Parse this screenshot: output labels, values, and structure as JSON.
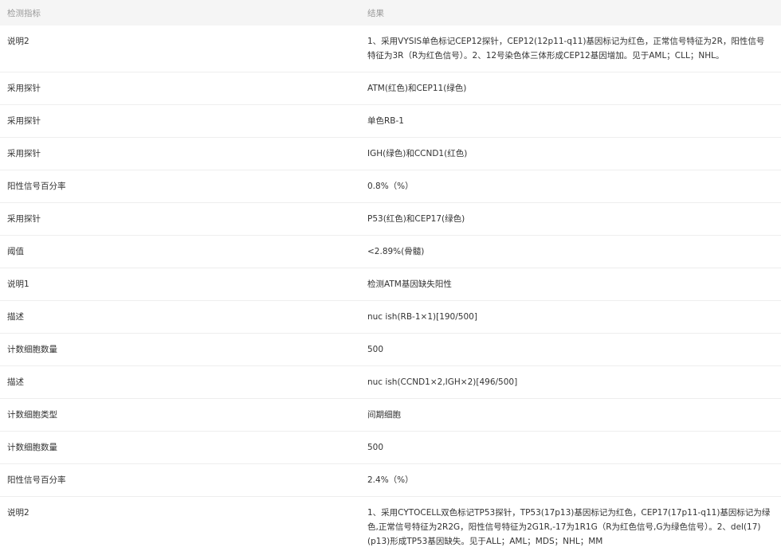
{
  "table": {
    "headers": [
      "检测指标",
      "结果"
    ],
    "rows": [
      {
        "name": "说明2",
        "result": "1、采用VYSIS单色标记CEP12探针，CEP12(12p11-q11)基因标记为红色，正常信号特征为2R，阳性信号特征为3R（R为红色信号）。2、12号染色体三体形成CEP12基因增加。见于AML；CLL；NHL。"
      },
      {
        "name": "采用探针",
        "result": "ATM(红色)和CEP11(绿色)"
      },
      {
        "name": "采用探针",
        "result": "单色RB-1"
      },
      {
        "name": "采用探针",
        "result": "IGH(绿色)和CCND1(红色)"
      },
      {
        "name": "阳性信号百分率",
        "result": "0.8%（%）"
      },
      {
        "name": "采用探针",
        "result": "P53(红色)和CEP17(绿色)"
      },
      {
        "name": "阈值",
        "result": "<2.89%(骨髓)"
      },
      {
        "name": "说明1",
        "result": "检测ATM基因缺失阳性"
      },
      {
        "name": "描述",
        "result": "nuc ish(RB-1×1)[190/500]"
      },
      {
        "name": "计数细胞数量",
        "result": "500"
      },
      {
        "name": "描述",
        "result": "nuc ish(CCND1×2,IGH×2)[496/500]"
      },
      {
        "name": "计数细胞类型",
        "result": "间期细胞"
      },
      {
        "name": "计数细胞数量",
        "result": "500"
      },
      {
        "name": "阳性信号百分率",
        "result": "2.4%（%）"
      },
      {
        "name": "说明2",
        "result": "1、采用CYTOCELL双色标记TP53探针，TP53(17p13)基因标记为红色，CEP17(17p11-q11)基因标记为绿色,正常信号特征为2R2G，阳性信号特征为2G1R,-17为1R1G（R为红色信号,G为绿色信号）。2、del(17)(p13)形成TP53基因缺失。见于ALL；AML；MDS；NHL；MM"
      }
    ]
  }
}
